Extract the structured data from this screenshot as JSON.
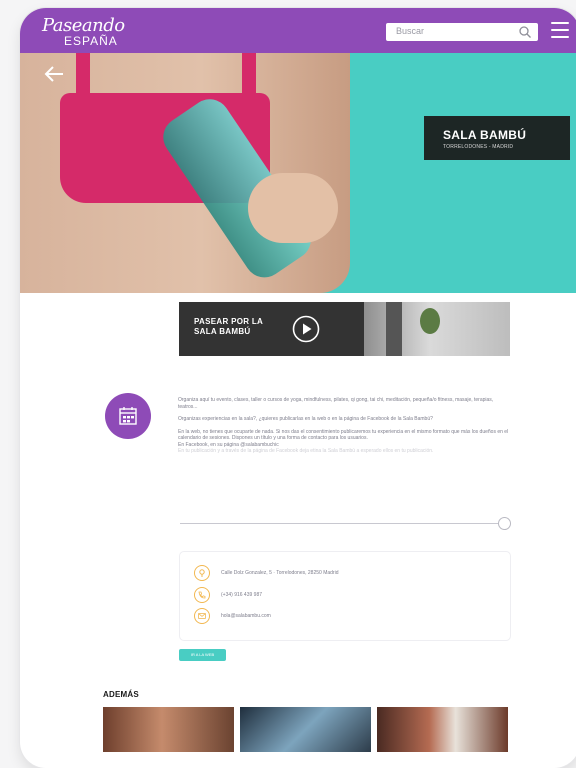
{
  "header": {
    "logo_line1": "Paseando",
    "logo_line2": "ESPAÑA",
    "search_placeholder": "Buscar",
    "icons": [
      "search-icon",
      "menu-icon"
    ]
  },
  "hero": {
    "back_icon": "arrow-left-icon",
    "place_title": "SALA BAMBÚ",
    "place_subtitle": "TORRELODONES - MADRID"
  },
  "tour": {
    "label": "PASEAR POR LA\nSALA BAMBÚ",
    "icon": "play-icon"
  },
  "description": {
    "icon": "calendar-icon",
    "paragraphs": [
      "Organiza aquí tu evento, clases, taller o cursos de yoga, mindfulness, pilates, qi gong, tai chi, meditación, pequeña/o fitness, masaje, terapias, teatros...",
      "Organizas experiencias en la sala?, ¿quieres publicarlas en la web o en la página de Facebook de la Sala Bambú?",
      "En la web, no tienes que ocuparte de nada. Si nos das el consentimiento publicaremos tu experiencia en el mismo formato que más los dueños en el calendario de sesiones. Dispones un título y una forma de contacto para los usuarios.",
      "En Facebook, en su página @salabambuchic",
      "En tu publicación y a través de la página de Facebook deja etina la Sala Bambú a esperado ellos en tu publicación."
    ]
  },
  "contact": {
    "address": "Calle Dolz Gonzalez, 5 · Torrelodones, 28250 Madrid",
    "phone": "(+34) 916 439 987",
    "email": "hola@salabambu.com",
    "icons": [
      "location-icon",
      "phone-icon",
      "mail-icon"
    ]
  },
  "web_button": "IR A LA WEB",
  "also": {
    "title": "ADEMÁS"
  },
  "colors": {
    "brand_purple": "#8e4bb7",
    "teal": "#49cdc3",
    "accent_orange": "#f2b851"
  }
}
